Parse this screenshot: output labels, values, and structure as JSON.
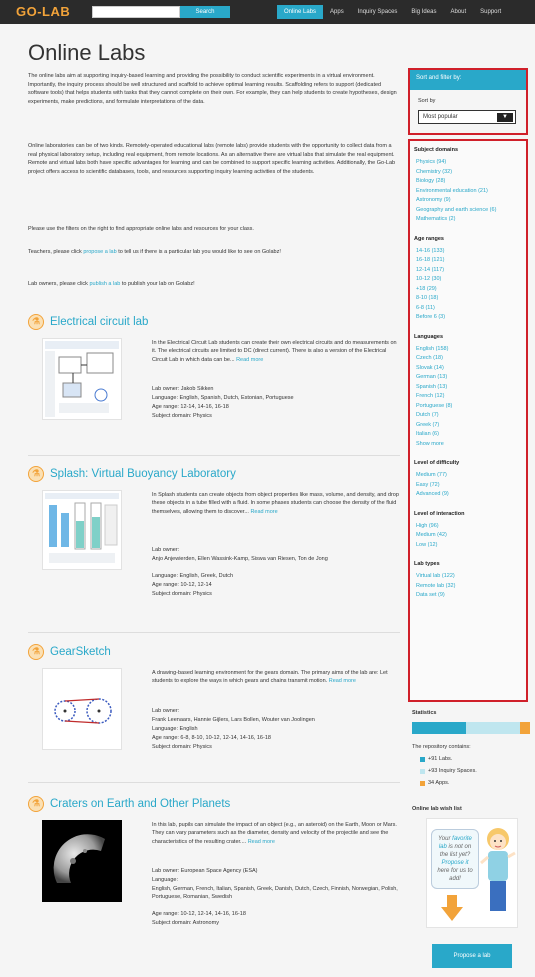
{
  "header": {
    "logo": "GO-LAB",
    "search_placeholder": "",
    "search_button": "Search",
    "nav": [
      "Online Labs",
      "Apps",
      "Inquiry Spaces",
      "Big Ideas",
      "About",
      "Support"
    ]
  },
  "page": {
    "title": "Online Labs",
    "intro_1": "The online labs aim at supporting inquiry-based learning and providing the possibility to conduct scientific experiments in a virtual environment. Importantly, the inquiry process should be well structured and scaffold to achieve optimal learning results. Scaffolding refers to support (dedicated software tools) that helps students with tasks that they cannot complete on their own. For example, they can help students to create hypotheses, design experiments, make predictions, and formulate interpretations of the data.",
    "intro_2": "Online laboratories can be of two kinds. Remotely-operated educational labs (remote labs) provide students with the opportunity to collect data from a real physical laboratory setup, including real equipment, from remote locations. As an alternative there are virtual labs that simulate the real equipment. Remote and virtual labs both have specific advantages for learning and can be combined to support specific learning activities. Additionally, the Go-Lab project offers access to scientific databases, tools, and resources supporting inquiry learning activities of the students.",
    "intro_3": "Please use the filters on the right to find appropriate online labs and resources for your class.",
    "teachers_pre": "Teachers, please click ",
    "teachers_link": "propose a lab",
    "teachers_post": " to tell us if there is a particular lab you would like to see on Golabz!",
    "owners_pre": "Lab owners, please click ",
    "owners_link": "publish a lab",
    "owners_post": " to publish your lab on Golabz!"
  },
  "labs": [
    {
      "title": "Electrical circuit lab",
      "desc": "In the Electrical Circuit Lab students can create their own electrical circuits and do measurements on it. The electrical circuits are limited to DC (direct current). There is also a version of the Electrical Circuit Lab in which data can be...",
      "read_more": "Read more",
      "owner": "Lab owner: Jakob Sikken",
      "language": "Language: English, Spanish, Dutch, Estonian, Portuguese",
      "age": "Age range: 12-14, 14-16, 16-18",
      "domain": "Subject domain: Physics"
    },
    {
      "title": "Splash: Virtual Buoyancy Laboratory",
      "desc": "In Splash students can create objects from object properties like mass, volume, and density, and drop these objects in a tube filled with a fluid. In some phases students can choose the density of the fluid themselves, allowing them to discover...",
      "read_more": "Read more",
      "owner": "Lab owner:",
      "owner_names": "Anjo Anjewierden, Ellen Wassink-Kamp, Siswa van Riesen, Ton de Jong",
      "language": "Language: English, Greek, Dutch",
      "age": "Age range: 10-12, 12-14",
      "domain": "Subject domain: Physics"
    },
    {
      "title": "GearSketch",
      "desc": "A drawing-based learning environment for the gears domain. The primary aims of the lab are: Let students to explore the ways in which gears and chains transmit motion.",
      "read_more": "Read more",
      "owner": "Lab owner:",
      "owner_names": "Frank Leenaars, Hannie Gijlers, Lars Bollen, Wouter van Joolingen",
      "language": "Language: English",
      "age": "Age range: 6-8, 8-10, 10-12, 12-14, 14-16, 16-18",
      "domain": "Subject domain: Physics"
    },
    {
      "title": "Craters on Earth and Other Planets",
      "desc": "In this lab, pupils can simulate the impact of an object (e.g., an asteroid) on the Earth, Moon or Mars. They can vary parameters such as the diameter, density and velocity of the projectile and see the characteristics of the resulting crater....",
      "read_more": "Read more",
      "owner": "Lab owner: European Space Agency (ESA)",
      "language": "Language:",
      "language_list": "English, German, French, Italian, Spanish, Greek, Danish, Dutch, Czech, Finnish, Norwegian, Polish, Portuguese, Romanian, Swedish",
      "age": "Age range: 10-12, 12-14, 14-16, 16-18",
      "domain": "Subject domain: Astronomy"
    }
  ],
  "sidebar": {
    "filter_title": "Sort and filter by:",
    "sort_label": "Sort by",
    "sort_value": "Most popular",
    "facets": [
      {
        "head": "Subject domains",
        "items": [
          "Physics (94)",
          "Chemistry (32)",
          "Biology (28)",
          "Environmental education (21)",
          "Astronomy (9)",
          "Geography and earth science (6)",
          "Mathematics (2)"
        ]
      },
      {
        "head": "Age ranges",
        "items": [
          "14-16 (133)",
          "16-18 (121)",
          "12-14 (117)",
          "10-12 (30)",
          "+18 (29)",
          "8-10 (18)",
          "6-8 (11)",
          "Before 6 (3)"
        ]
      },
      {
        "head": "Languages",
        "items": [
          "English (158)",
          "Czech (18)",
          "Slovak (14)",
          "German (13)",
          "Spanish (13)",
          "French (12)",
          "Portuguese (8)",
          "Dutch (7)",
          "Greek (7)",
          "Italian (6)",
          "Show more"
        ]
      },
      {
        "head": "Level of difficulty",
        "items": [
          "Medium (77)",
          "Easy (72)",
          "Advanced (9)"
        ]
      },
      {
        "head": "Level of interaction",
        "items": [
          "High (96)",
          "Medium (42)",
          "Low (12)"
        ]
      },
      {
        "head": "Lab types",
        "items": [
          "Virtual lab (122)",
          "Remote lab (32)",
          "Data set (9)"
        ]
      }
    ],
    "stats_title": "Statistics",
    "repo_label": "The repository contains:",
    "stats": [
      {
        "label": "+91 Labs.",
        "color": "#29a8c9",
        "value": 191
      },
      {
        "label": "+93 Inquiry Spaces.",
        "color": "#bfe6ef",
        "value": 193
      },
      {
        "label": "34 Apps.",
        "color": "#f2a33a",
        "value": 34
      }
    ],
    "wishlist_title": "Online lab wish list",
    "bubble_1": "Your ",
    "bubble_hl1": "favorite lab",
    "bubble_2": " is not on the list yet?",
    "bubble_hl2": "Propose it",
    "bubble_3": " here for us to add!",
    "propose_button": "Propose a lab"
  },
  "colors": {
    "accent": "#29a8c9",
    "brand_orange": "#f2a33a",
    "highlight_red": "#d0202a"
  }
}
